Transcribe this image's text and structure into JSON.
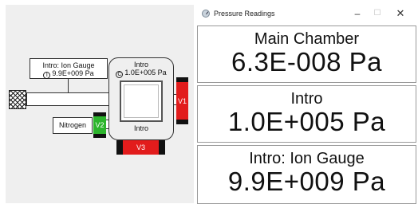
{
  "window": {
    "title": "Pressure Readings",
    "minimize_glyph": "–",
    "maximize_glyph": "☐",
    "close_glyph": "✕"
  },
  "readings": [
    {
      "label": "Main Chamber",
      "value": "6.3E-008 Pa"
    },
    {
      "label": "Intro",
      "value": "1.0E+005 Pa"
    },
    {
      "label": "Intro: Ion Gauge",
      "value": "9.9E+009 Pa"
    }
  ],
  "schematic": {
    "ion_gauge_box": {
      "title": "Intro: Ion Gauge",
      "icon_glyph": "I",
      "value": "9.9E+009 Pa"
    },
    "chamber_gauge_box": {
      "title": "Intro",
      "icon_glyph": "C",
      "value": "1.0E+005 Pa"
    },
    "chamber_label": "Intro",
    "nitrogen_label": "Nitrogen",
    "valves": {
      "v1": {
        "label": "V1",
        "color": "#e21c1c"
      },
      "v2": {
        "label": "V2",
        "color": "#2db52d"
      },
      "v3": {
        "label": "V3",
        "color": "#e21c1c"
      }
    }
  }
}
